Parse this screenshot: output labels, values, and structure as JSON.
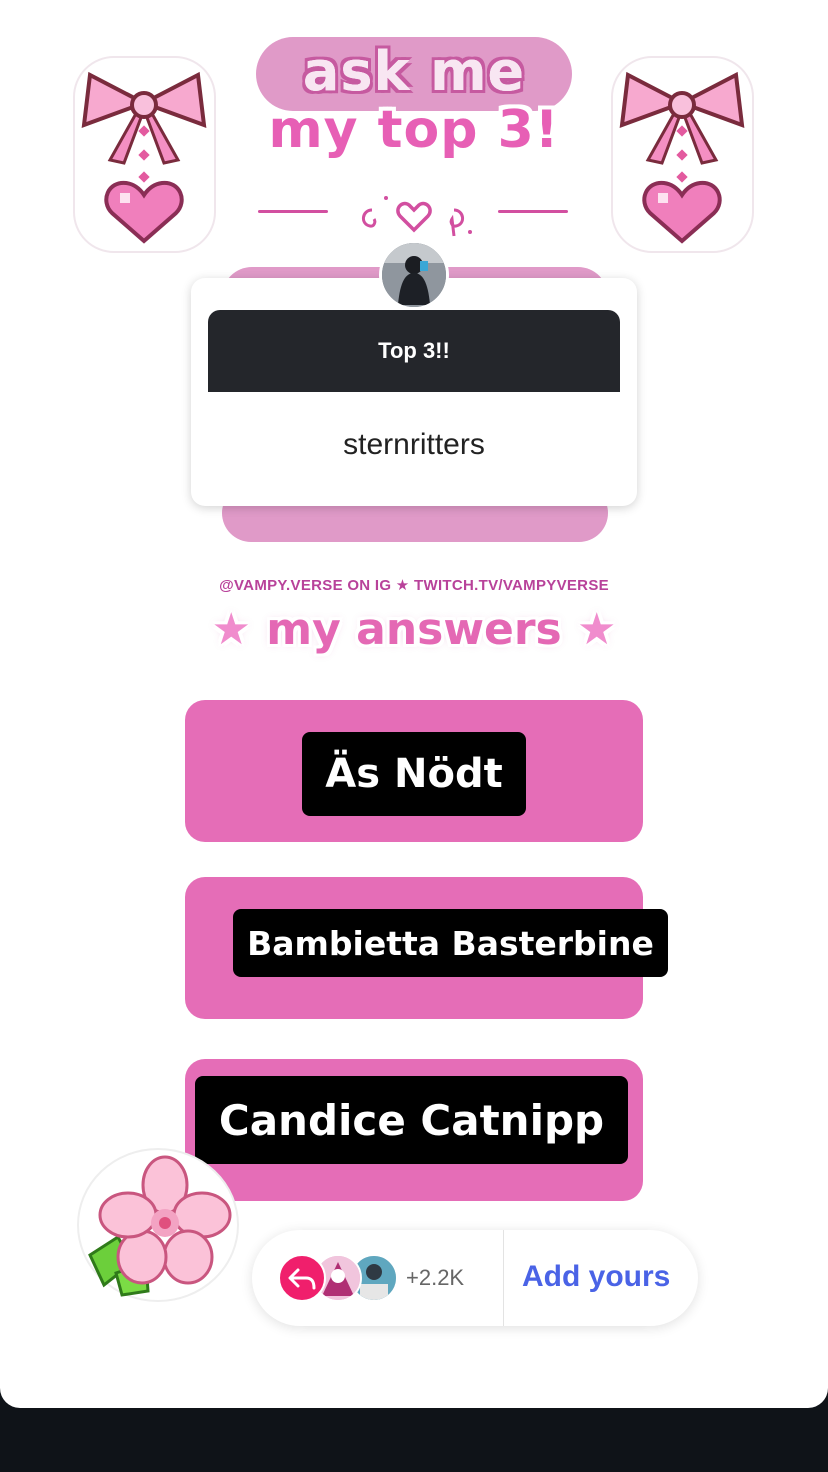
{
  "title": {
    "line1": "ask me",
    "line2": "my top 3!"
  },
  "question": {
    "header": "Top 3!!",
    "author": "sternritters"
  },
  "credits": "@VAMPY.VERSE ON IG ★ TWITCH.TV/VAMPYVERSE",
  "section_heading": "my answers",
  "answers": [
    {
      "label": "Äs Nödt"
    },
    {
      "label": "Bambietta Basterbine"
    },
    {
      "label": "Candice Catnipp"
    }
  ],
  "reply_bar": {
    "count": "+2.2K",
    "add_label": "Add yours"
  },
  "colors": {
    "pink": "#e56db7",
    "pink_light": "#e09ac8",
    "accent_red": "#f01f6c",
    "link_blue": "#4a63e6"
  },
  "icons": [
    "bow-heart-sticker",
    "reply-icon",
    "flower-sticker"
  ]
}
